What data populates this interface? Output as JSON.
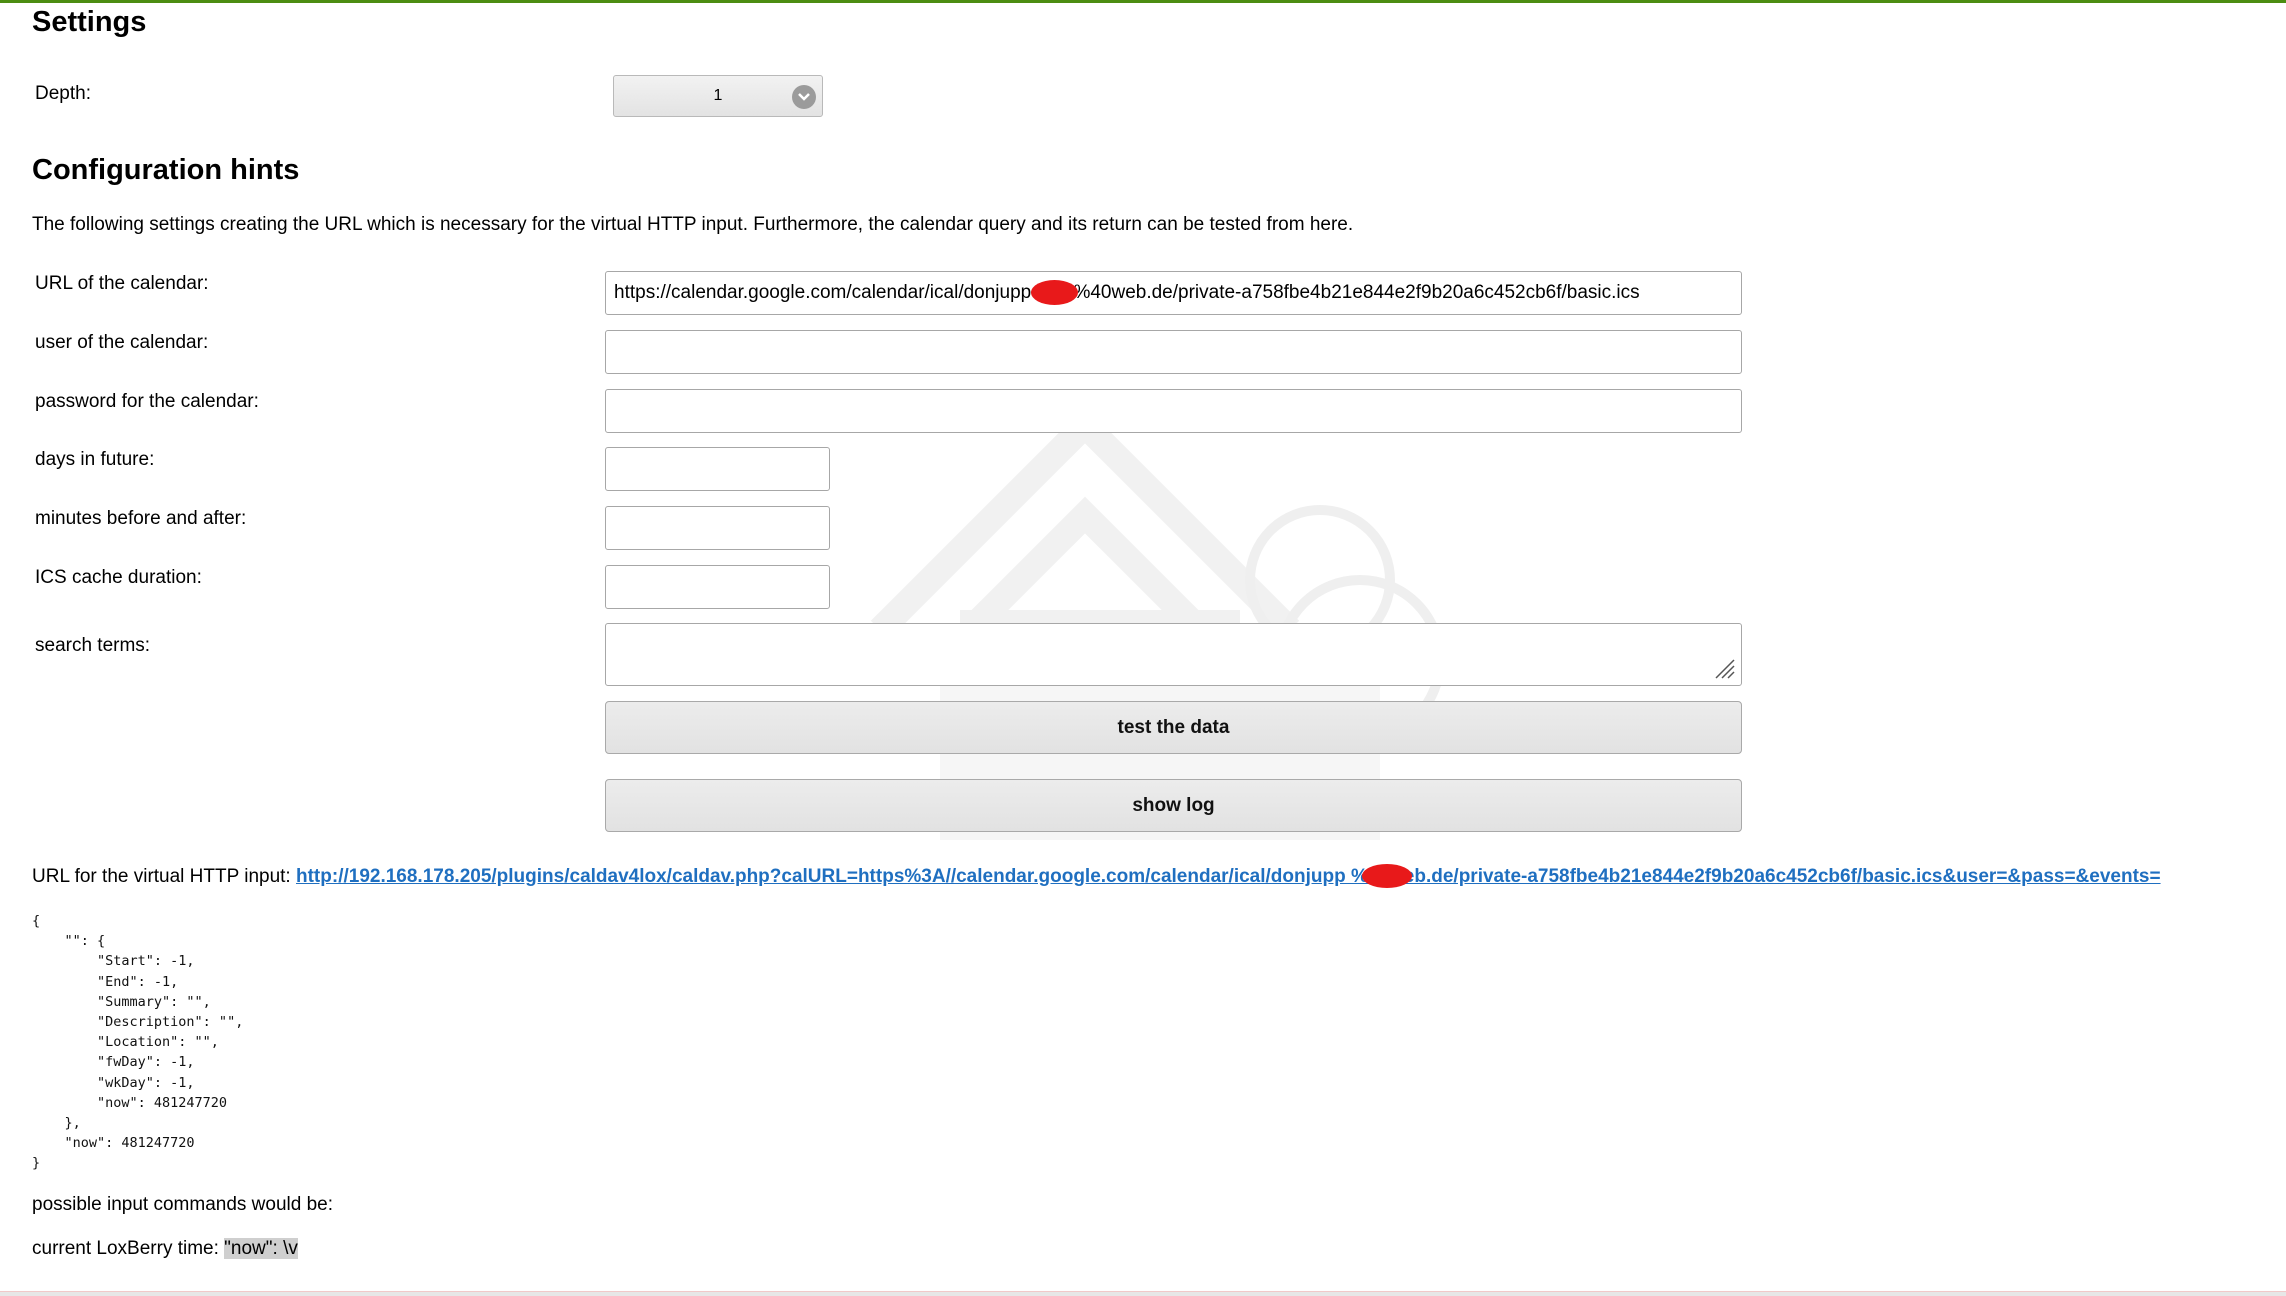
{
  "settings": {
    "title": "Settings",
    "depth_label": "Depth:",
    "depth_value": "1"
  },
  "hints": {
    "title": "Configuration hints",
    "description": "The following settings creating the URL which is necessary for the virtual HTTP input. Furthermore, the calendar query and its return can be tested from here."
  },
  "form": {
    "url_label": "URL of the calendar:",
    "url_value": "https://calendar.google.com/calendar/ical/donjupp        %40web.de/private-a758fbe4b21e844e2f9b20a6c452cb6f/basic.ics",
    "user_label": "user of the calendar:",
    "user_value": "",
    "password_label": "password for the calendar:",
    "password_value": "",
    "days_label": "days in future:",
    "days_value": "",
    "minutes_label": "minutes before and after:",
    "minutes_value": "",
    "cache_label": "ICS cache duration:",
    "cache_value": "",
    "search_label": "search terms:",
    "search_value": "",
    "test_button": "test the data",
    "log_button": "show log"
  },
  "virtual_input": {
    "label": "URL for the virtual HTTP input: ",
    "link_text": "http://192.168.178.205/plugins/caldav4lox/caldav.php?calURL=https%3A//calendar.google.com/calendar/ical/donjupp        %40web.de/private-a758fbe4b21e844e2f9b20a6c452cb6f/basic.ics&user=&pass=&events="
  },
  "json_output": "{\n    \"\": {\n        \"Start\": -1,\n        \"End\": -1,\n        \"Summary\": \"\",\n        \"Description\": \"\",\n        \"Location\": \"\",\n        \"fwDay\": -1,\n        \"wkDay\": -1,\n        \"now\": 481247720\n    },\n    \"now\": 481247720\n}",
  "commands": {
    "label": "possible input commands would be:"
  },
  "time": {
    "label": "current LoxBerry time: ",
    "value": "\"now\": \\v"
  },
  "colors": {
    "accent_line": "#4c8d12",
    "link": "#1f6fc0",
    "redaction": "#e8191a"
  }
}
